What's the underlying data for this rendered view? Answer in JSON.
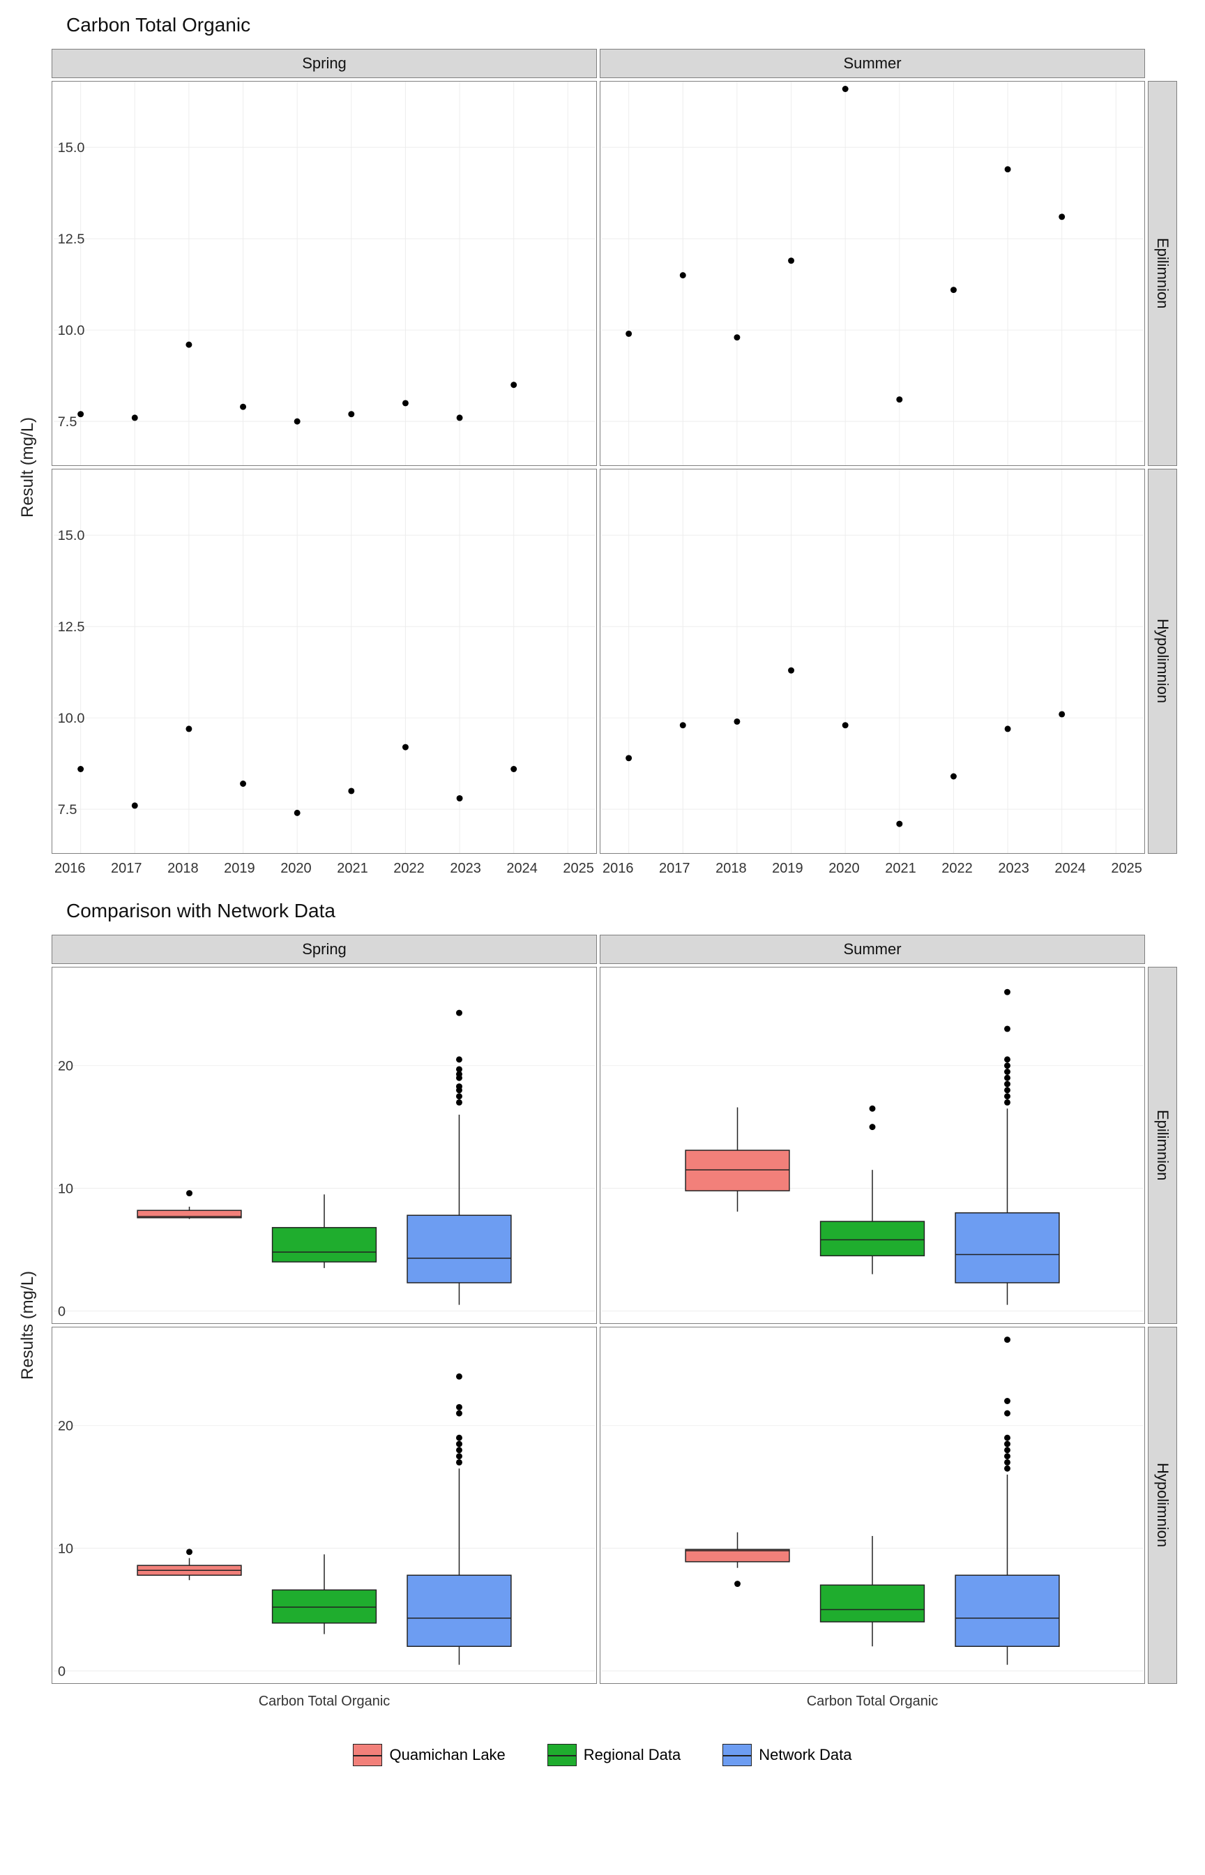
{
  "chart_data": [
    {
      "type": "scatter",
      "title": "Carbon Total Organic",
      "ylabel": "Result (mg/L)",
      "facets_col": [
        "Spring",
        "Summer"
      ],
      "facets_row": [
        "Epilimnion",
        "Hypolimnion"
      ],
      "x_ticks": [
        2016,
        2017,
        2018,
        2019,
        2020,
        2021,
        2022,
        2023,
        2024,
        2025
      ],
      "ylim": [
        6.3,
        16.8
      ],
      "y_ticks": [
        7.5,
        10.0,
        12.5,
        15.0
      ],
      "points": {
        "Spring_Epilimnion": [
          [
            2016,
            7.7
          ],
          [
            2017,
            7.6
          ],
          [
            2018,
            9.6
          ],
          [
            2019,
            7.9
          ],
          [
            2020,
            7.5
          ],
          [
            2021,
            7.7
          ],
          [
            2022,
            8.0
          ],
          [
            2023,
            7.6
          ],
          [
            2024,
            8.5
          ]
        ],
        "Summer_Epilimnion": [
          [
            2016,
            9.9
          ],
          [
            2017,
            11.5
          ],
          [
            2018,
            9.8
          ],
          [
            2019,
            11.9
          ],
          [
            2020,
            16.6
          ],
          [
            2021,
            8.1
          ],
          [
            2022,
            11.1
          ],
          [
            2023,
            14.4
          ],
          [
            2024,
            13.1
          ]
        ],
        "Spring_Hypolimnion": [
          [
            2016,
            8.6
          ],
          [
            2017,
            7.6
          ],
          [
            2018,
            9.7
          ],
          [
            2019,
            8.2
          ],
          [
            2020,
            7.4
          ],
          [
            2021,
            8.0
          ],
          [
            2022,
            9.2
          ],
          [
            2023,
            7.8
          ],
          [
            2024,
            8.6
          ]
        ],
        "Summer_Hypolimnion": [
          [
            2016,
            8.9
          ],
          [
            2017,
            9.8
          ],
          [
            2018,
            9.9
          ],
          [
            2019,
            11.3
          ],
          [
            2020,
            9.8
          ],
          [
            2021,
            7.1
          ],
          [
            2022,
            8.4
          ],
          [
            2023,
            9.7
          ],
          [
            2024,
            10.1
          ]
        ]
      }
    },
    {
      "type": "boxplot",
      "title": "Comparison with Network Data",
      "ylabel": "Results (mg/L)",
      "facets_col": [
        "Spring",
        "Summer"
      ],
      "facets_row": [
        "Epilimnion",
        "Hypolimnion"
      ],
      "x_category": "Carbon Total Organic",
      "ylim": [
        -1,
        28
      ],
      "y_ticks": [
        0,
        10,
        20
      ],
      "legend": [
        {
          "name": "Quamichan Lake",
          "color": "#f2807a"
        },
        {
          "name": "Regional Data",
          "color": "#1fad2e"
        },
        {
          "name": "Network Data",
          "color": "#6d9df2"
        }
      ],
      "boxes": {
        "Spring_Epilimnion": {
          "Quamichan Lake": {
            "min": 7.5,
            "q1": 7.6,
            "med": 7.7,
            "q3": 8.2,
            "max": 8.5,
            "outliers": [
              9.6
            ]
          },
          "Regional Data": {
            "min": 3.5,
            "q1": 4.0,
            "med": 4.8,
            "q3": 6.8,
            "max": 9.5,
            "outliers": []
          },
          "Network Data": {
            "min": 0.5,
            "q1": 2.3,
            "med": 4.3,
            "q3": 7.8,
            "max": 16.0,
            "outliers": [
              17,
              17.5,
              18,
              18.3,
              19,
              19.3,
              19.7,
              20.5,
              24.3
            ]
          }
        },
        "Summer_Epilimnion": {
          "Quamichan Lake": {
            "min": 8.1,
            "q1": 9.8,
            "med": 11.5,
            "q3": 13.1,
            "max": 16.6,
            "outliers": []
          },
          "Regional Data": {
            "min": 3.0,
            "q1": 4.5,
            "med": 5.8,
            "q3": 7.3,
            "max": 11.5,
            "outliers": [
              15,
              16.5
            ]
          },
          "Network Data": {
            "min": 0.5,
            "q1": 2.3,
            "med": 4.6,
            "q3": 8.0,
            "max": 16.5,
            "outliers": [
              17,
              17.5,
              18,
              18.5,
              19,
              19.5,
              20,
              20.5,
              23,
              26
            ]
          }
        },
        "Spring_Hypolimnion": {
          "Quamichan Lake": {
            "min": 7.4,
            "q1": 7.8,
            "med": 8.2,
            "q3": 8.6,
            "max": 9.2,
            "outliers": [
              9.7
            ]
          },
          "Regional Data": {
            "min": 3.0,
            "q1": 3.9,
            "med": 5.2,
            "q3": 6.6,
            "max": 9.5,
            "outliers": []
          },
          "Network Data": {
            "min": 0.5,
            "q1": 2.0,
            "med": 4.3,
            "q3": 7.8,
            "max": 16.5,
            "outliers": [
              17,
              17.5,
              18,
              18.5,
              19,
              21,
              21.5,
              24
            ]
          }
        },
        "Summer_Hypolimnion": {
          "Quamichan Lake": {
            "min": 8.4,
            "q1": 8.9,
            "med": 9.8,
            "q3": 9.9,
            "max": 11.3,
            "outliers": [
              7.1
            ]
          },
          "Regional Data": {
            "min": 2.0,
            "q1": 4.0,
            "med": 5.0,
            "q3": 7.0,
            "max": 11.0,
            "outliers": []
          },
          "Network Data": {
            "min": 0.5,
            "q1": 2.0,
            "med": 4.3,
            "q3": 7.8,
            "max": 16.0,
            "outliers": [
              16.5,
              17,
              17.5,
              18,
              18.5,
              19,
              21,
              22,
              27
            ]
          }
        }
      }
    }
  ]
}
